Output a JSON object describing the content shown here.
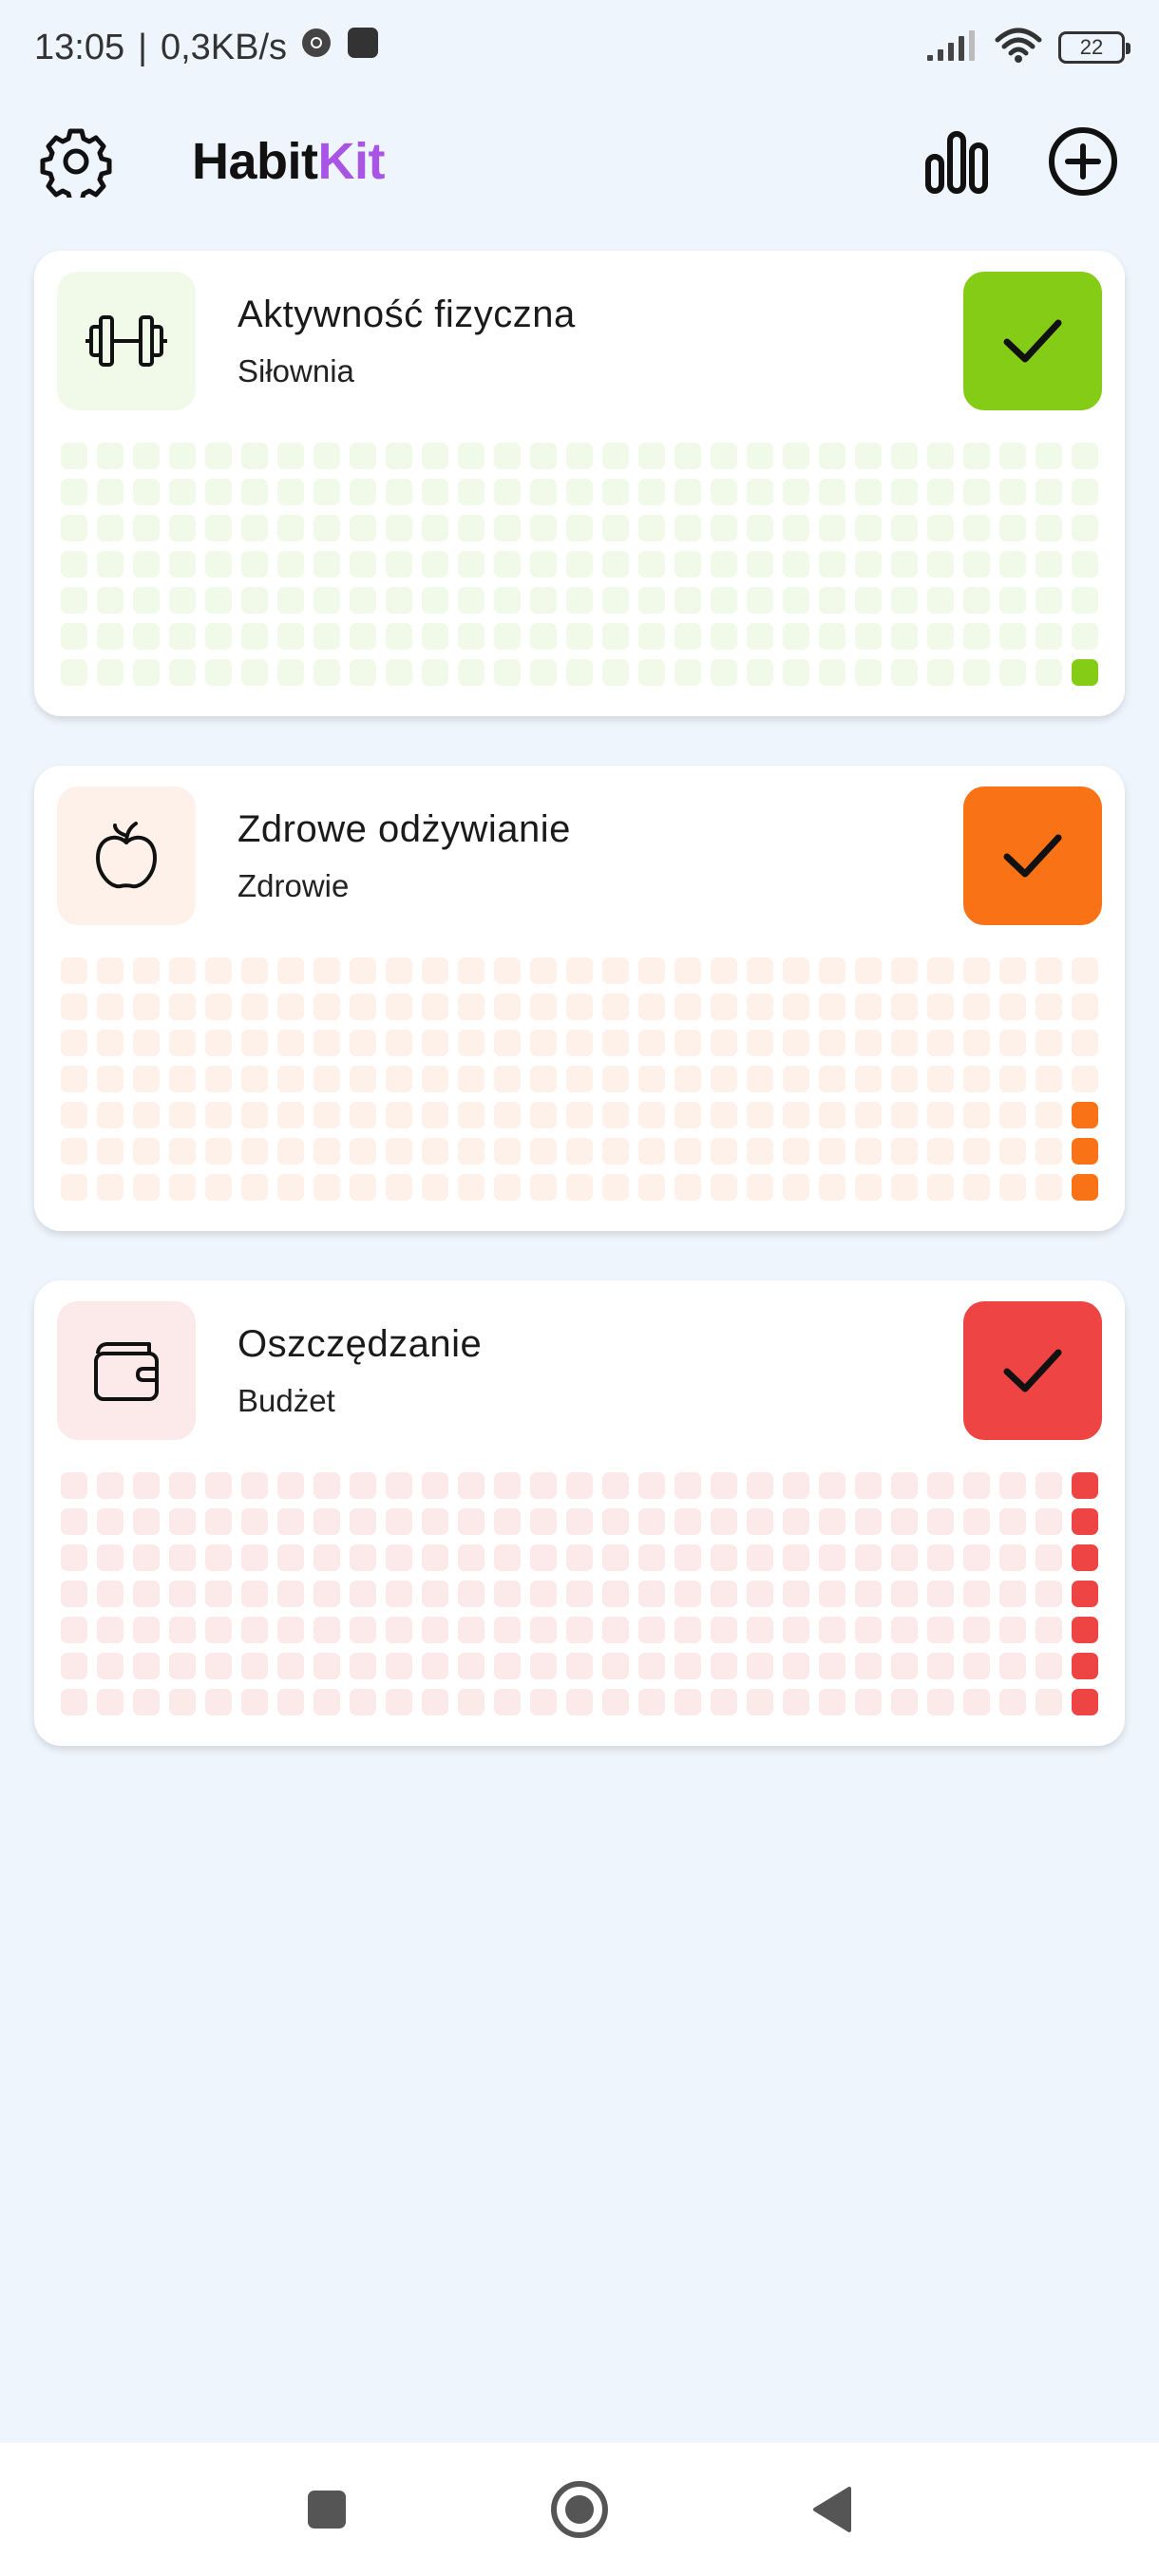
{
  "status_bar": {
    "time": "13:05",
    "separator": "|",
    "speed": "0,3KB/s",
    "battery": "22",
    "icons": [
      "chrome-icon",
      "app-notification-icon",
      "signal-icon",
      "wifi-icon",
      "battery-icon"
    ]
  },
  "app_bar": {
    "title_part1": "Habit",
    "title_part2": "Kit",
    "brand_color": "#a855e6",
    "icons": [
      "settings-gear-icon",
      "statistics-bar-chart-icon",
      "add-circle-icon"
    ]
  },
  "habits": [
    {
      "title": "Aktywność fizyczna",
      "subtitle": "Siłownia",
      "icon": "dumbbell-icon",
      "accent": "#84cc16",
      "tint": "#f1f9e8",
      "completed_cells": [
        202
      ]
    },
    {
      "title": "Zdrowe odżywianie",
      "subtitle": "Zdrowie",
      "icon": "apple-icon",
      "accent": "#f97316",
      "tint": "#fdf1ea",
      "completed_cells": [
        144,
        173,
        202
      ]
    },
    {
      "title": "Oszczędzanie",
      "subtitle": "Budżet",
      "icon": "wallet-icon",
      "accent": "#ef4444",
      "tint": "#fce9ea",
      "completed_cells": [
        28,
        57,
        86,
        115,
        144,
        173,
        202
      ]
    }
  ],
  "nav_bar": {
    "icons": [
      "recent-apps-icon",
      "home-icon",
      "back-icon"
    ]
  }
}
